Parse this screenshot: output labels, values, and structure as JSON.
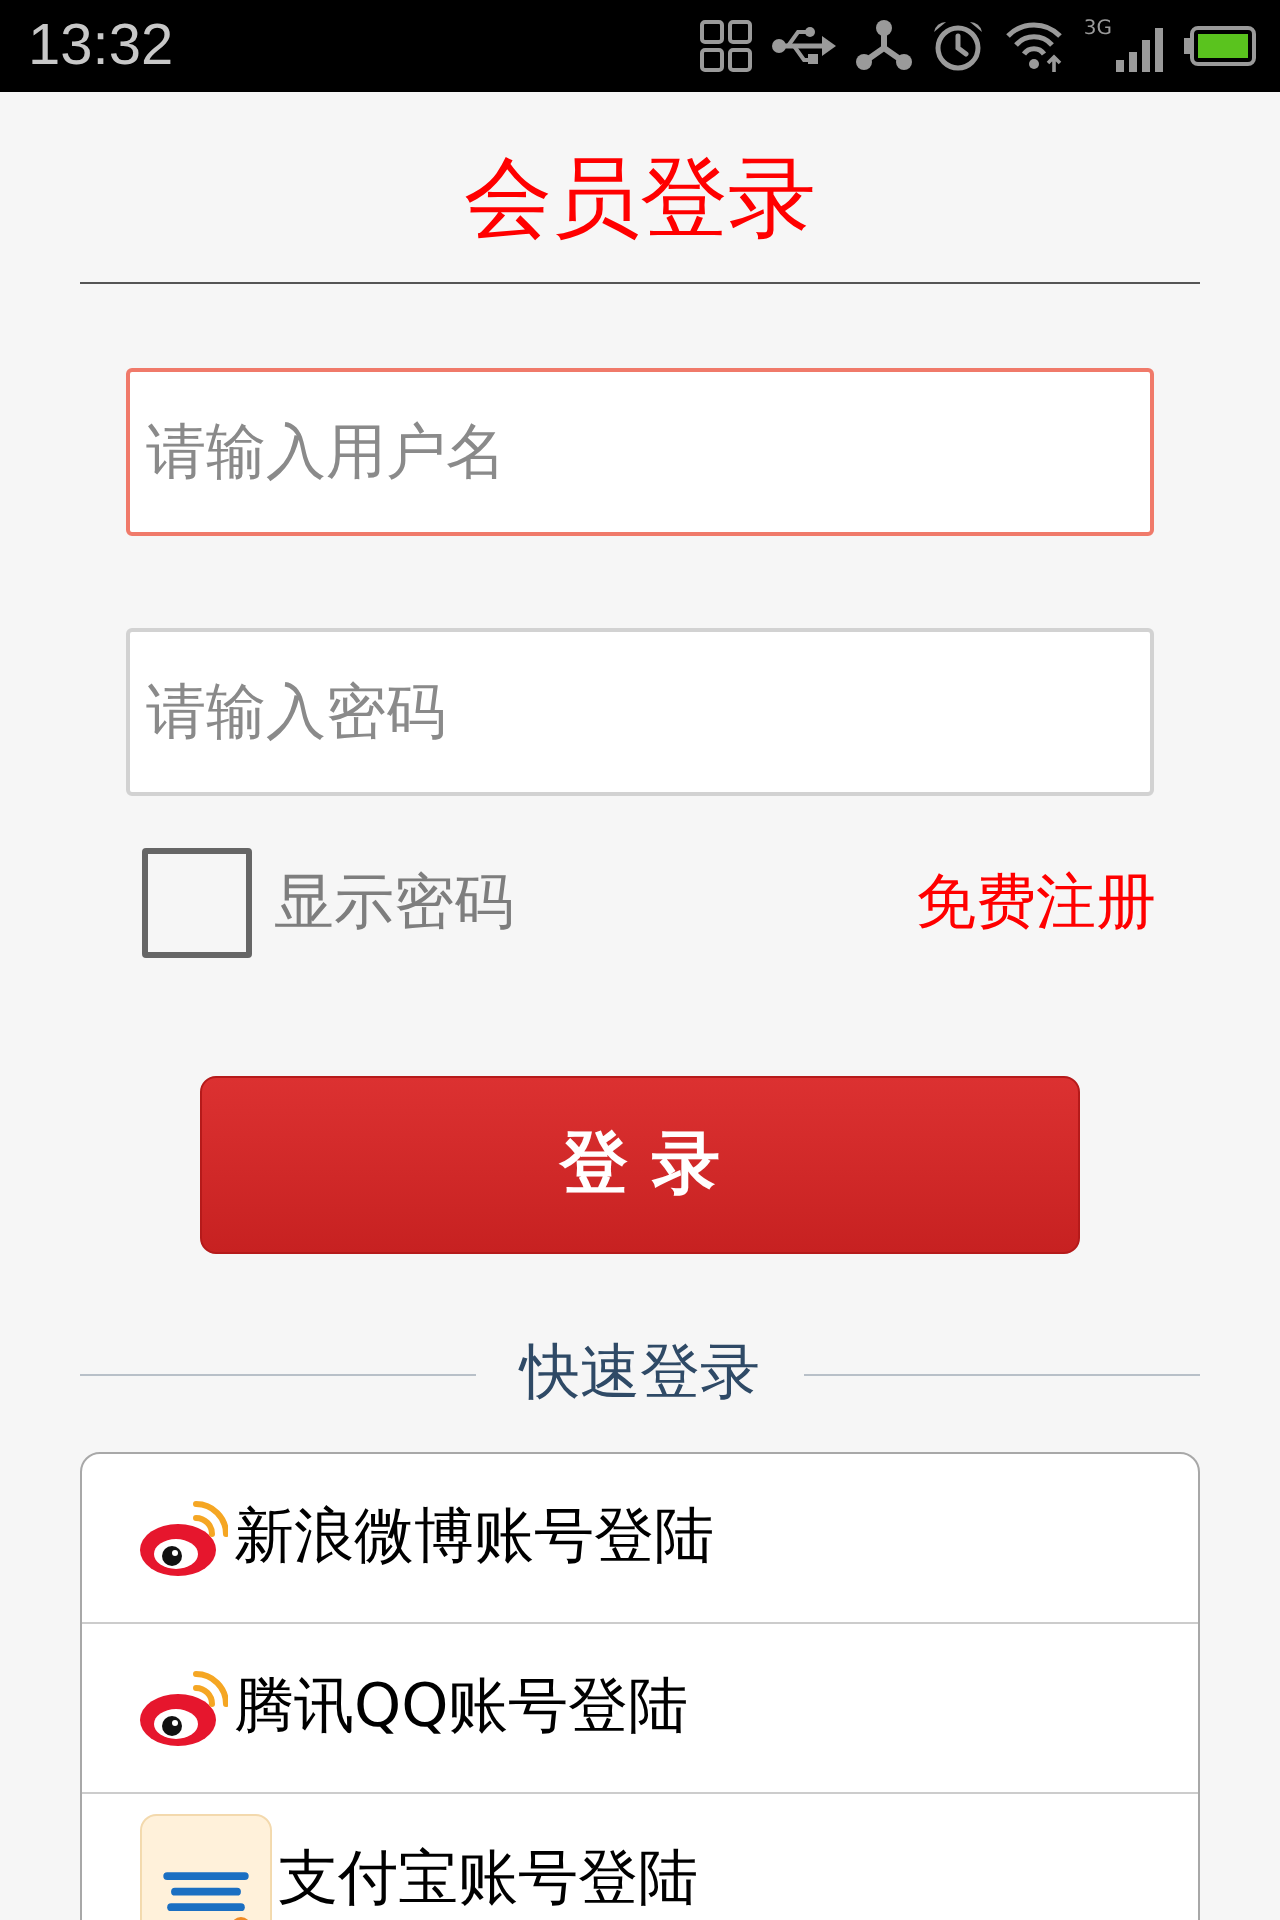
{
  "status_bar": {
    "time": "13:32",
    "network": "3G"
  },
  "title": "会员登录",
  "fields": [
    {
      "placeholder": "请输入用户名",
      "focused": true
    },
    {
      "placeholder": "请输入密码",
      "focused": false
    }
  ],
  "show_password": {
    "label": "显示密码",
    "checked": false
  },
  "register_link": "免费注册",
  "login_button": "登 录",
  "quick_login": {
    "heading": "快速登录",
    "items": [
      {
        "label": "新浪微博账号登陆",
        "kind": "weibo"
      },
      {
        "label": "腾讯QQ账号登陆",
        "kind": "weibo"
      },
      {
        "label": "支付宝账号登陆",
        "kind": "alipay"
      }
    ]
  }
}
